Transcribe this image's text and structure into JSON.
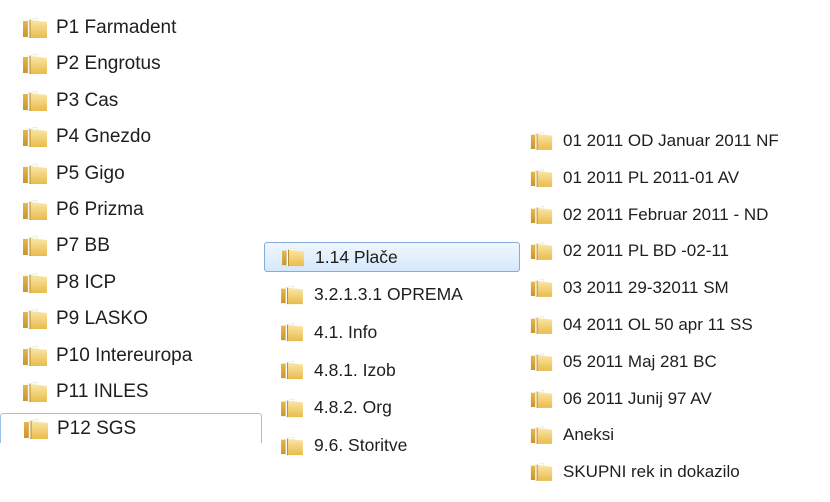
{
  "icon": "folder-icon",
  "colors": {
    "folder_light": "#f8dd8e",
    "folder_dark": "#d9a635",
    "selection_border": "#84acdd",
    "text": "#1e1e1e"
  },
  "col1": {
    "items": [
      {
        "label": "P1 Farmadent"
      },
      {
        "label": "P2 Engrotus"
      },
      {
        "label": "P3 Cas"
      },
      {
        "label": "P4 Gnezdo"
      },
      {
        "label": "P5 Gigo"
      },
      {
        "label": "P6 Prizma"
      },
      {
        "label": "P7 BB"
      },
      {
        "label": "P8 ICP"
      },
      {
        "label": "P9 LASKO"
      },
      {
        "label": "P10 Intereuropa"
      },
      {
        "label": "P11 INLES"
      },
      {
        "label": "P12 SGS"
      }
    ]
  },
  "col2": {
    "items": [
      {
        "label": "1.14 Plače"
      },
      {
        "label": "3.2.1.3.1 OPREMA"
      },
      {
        "label": "4.1. Info"
      },
      {
        "label": "4.8.1. Izob"
      },
      {
        "label": "4.8.2. Org"
      },
      {
        "label": "9.6. Storitve"
      }
    ]
  },
  "col3": {
    "items": [
      {
        "label": "01 2011 OD Januar 2011 NF"
      },
      {
        "label": "01 2011 PL 2011-01 AV"
      },
      {
        "label": "02 2011 Februar 2011 - ND"
      },
      {
        "label": "02 2011 PL BD -02-11"
      },
      {
        "label": "03 2011 29-32011 SM"
      },
      {
        "label": "04 2011 OL 50 apr 11 SS"
      },
      {
        "label": "05 2011 Maj 281 BC"
      },
      {
        "label": "06 2011 Junij 97 AV"
      },
      {
        "label": "Aneksi"
      },
      {
        "label": "SKUPNI rek in dokazilo"
      }
    ]
  }
}
